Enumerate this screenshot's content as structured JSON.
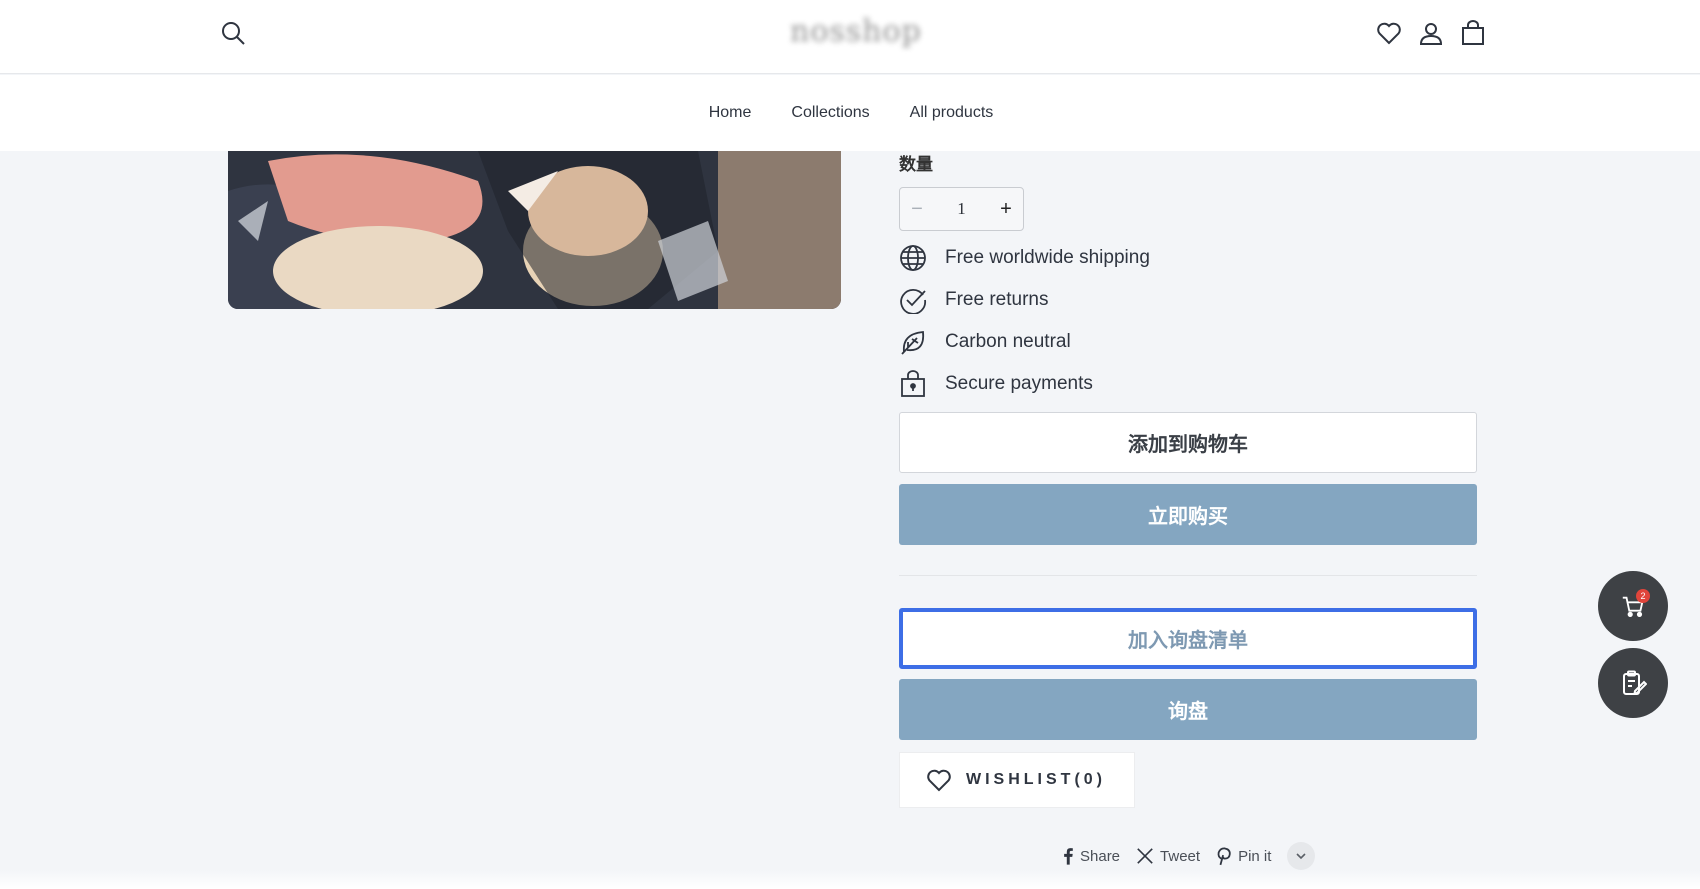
{
  "header": {
    "logo_text": "nosshop",
    "icons": [
      "search-icon",
      "heart-icon",
      "user-icon",
      "shopping-bag-icon"
    ]
  },
  "nav": {
    "items": [
      {
        "label": "Home"
      },
      {
        "label": "Collections"
      },
      {
        "label": "All products"
      }
    ]
  },
  "product": {
    "quantity_label": "数量",
    "quantity_value": "1",
    "quantity_minus": "−",
    "quantity_plus": "+",
    "features": [
      {
        "icon": "globe-icon",
        "label": "Free worldwide shipping"
      },
      {
        "icon": "check-circle-icon",
        "label": "Free returns"
      },
      {
        "icon": "leaf-icon",
        "label": "Carbon neutral"
      },
      {
        "icon": "lock-bag-icon",
        "label": "Secure payments"
      }
    ],
    "add_to_cart_label": "添加到购物车",
    "buy_now_label": "立即购买",
    "add_to_inquiry_label": "加入询盘清单",
    "inquiry_label": "询盘",
    "wishlist_label": "WISHLIST(0)"
  },
  "share": {
    "items": [
      {
        "icon": "facebook-icon",
        "label": "Share"
      },
      {
        "icon": "x-twitter-icon",
        "label": "Tweet"
      },
      {
        "icon": "pinterest-icon",
        "label": "Pin it"
      }
    ]
  },
  "floating": {
    "cart_badge": "2"
  },
  "colors": {
    "accent_button": "#84a6c1",
    "focus_outline": "#3d6ee6",
    "fab_bg": "#3e4145",
    "badge": "#e0453b"
  }
}
